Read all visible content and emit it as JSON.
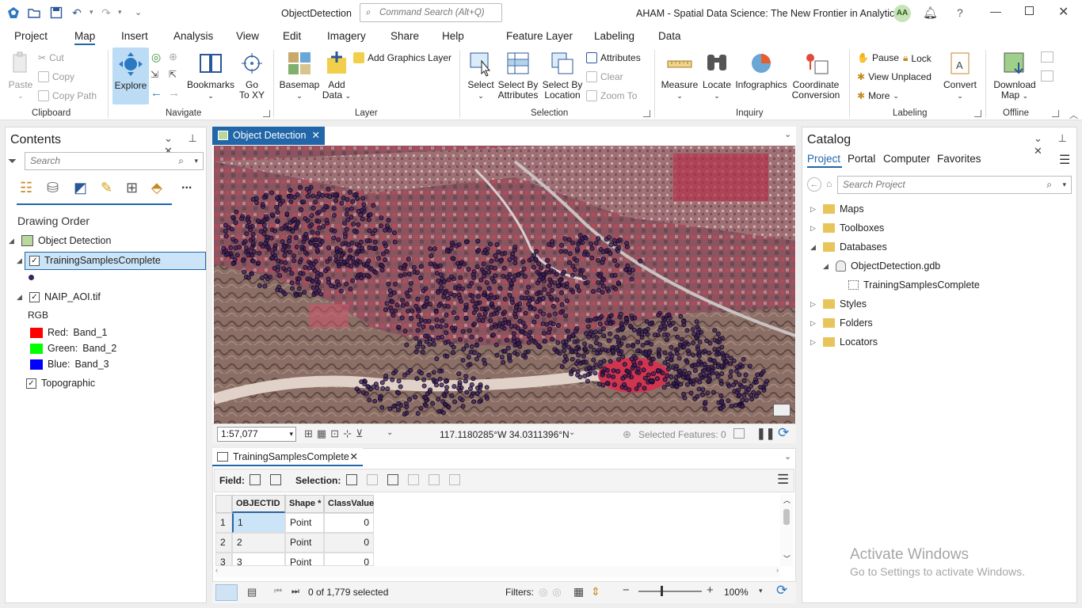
{
  "titlebar": {
    "doc_title": "ObjectDetection",
    "search_placeholder": "Command Search (Alt+Q)",
    "project_title": "AHAM - Spatial Data Science:  The New Frontier in Analytics",
    "avatar": "AA",
    "help": "?"
  },
  "tabs": [
    "Project",
    "Map",
    "Insert",
    "Analysis",
    "View",
    "Edit",
    "Imagery",
    "Share",
    "Help"
  ],
  "context_tabs": [
    "Feature Layer",
    "Labeling",
    "Data"
  ],
  "ribbon": {
    "clipboard": {
      "group": "Clipboard",
      "paste": "Paste",
      "cut": "Cut",
      "copy": "Copy",
      "copy_path": "Copy Path"
    },
    "navigate": {
      "group": "Navigate",
      "explore": "Explore",
      "bookmarks": "Bookmarks",
      "goto_l1": "Go",
      "goto_l2": "To XY"
    },
    "layer": {
      "group": "Layer",
      "basemap": "Basemap",
      "add_data_l1": "Add",
      "add_data_l2": "Data",
      "add_graphics": "Add Graphics Layer"
    },
    "selection": {
      "group": "Selection",
      "select": "Select",
      "by_attr_l1": "Select By",
      "by_attr_l2": "Attributes",
      "by_loc_l1": "Select By",
      "by_loc_l2": "Location",
      "attributes": "Attributes",
      "clear": "Clear",
      "zoom_to": "Zoom To"
    },
    "inquiry": {
      "group": "Inquiry",
      "measure": "Measure",
      "locate": "Locate",
      "infographics": "Infographics",
      "coord_l1": "Coordinate",
      "coord_l2": "Conversion"
    },
    "labeling": {
      "group": "Labeling",
      "pause": "Pause",
      "lock": "Lock",
      "view_unplaced": "View Unplaced",
      "more": "More",
      "convert": "Convert"
    },
    "offline": {
      "group": "Offline",
      "download_l1": "Download",
      "download_l2": "Map"
    }
  },
  "contents": {
    "title": "Contents",
    "search_placeholder": "Search",
    "more": "...",
    "drawing_order": "Drawing Order",
    "map_name": "Object Detection",
    "layer1": "TrainingSamplesComplete",
    "layer2": "NAIP_AOI.tif",
    "rgb": "RGB",
    "bands": [
      {
        "label": "Red:",
        "band": "Band_1",
        "color": "#ff0000"
      },
      {
        "label": "Green:",
        "band": "Band_2",
        "color": "#00ff00"
      },
      {
        "label": "Blue:",
        "band": "Band_3",
        "color": "#0000ff"
      }
    ],
    "layer3": "Topographic"
  },
  "mapview": {
    "tab_title": "Object Detection",
    "scale": "1:57,077",
    "coordinates": "117.1180285°W 34.0311396°N",
    "selected_features": "Selected Features: 0"
  },
  "table": {
    "tab_title": "TrainingSamplesComplete",
    "field_label": "Field:",
    "selection_label": "Selection:",
    "columns": [
      "OBJECTID *",
      "Shape *",
      "ClassValue"
    ],
    "rows": [
      {
        "n": "1",
        "id": "1",
        "shape": "Point",
        "cls": "0"
      },
      {
        "n": "2",
        "id": "2",
        "shape": "Point",
        "cls": "0"
      },
      {
        "n": "3",
        "id": "3",
        "shape": "Point",
        "cls": "0"
      }
    ],
    "count": "0 of 1,779 selected",
    "filters": "Filters:",
    "zoom": "100%"
  },
  "catalog": {
    "title": "Catalog",
    "tabs": [
      "Project",
      "Portal",
      "Computer",
      "Favorites"
    ],
    "search_placeholder": "Search Project",
    "items": [
      "Maps",
      "Toolboxes",
      "Databases",
      "ObjectDetection.gdb",
      "TrainingSamplesComplete",
      "Styles",
      "Folders",
      "Locators"
    ]
  },
  "watermark": {
    "line1": "Activate Windows",
    "line2": "Go to Settings to activate Windows."
  },
  "colors": {
    "accent": "#2166a8",
    "points": "#3b1f5e"
  }
}
